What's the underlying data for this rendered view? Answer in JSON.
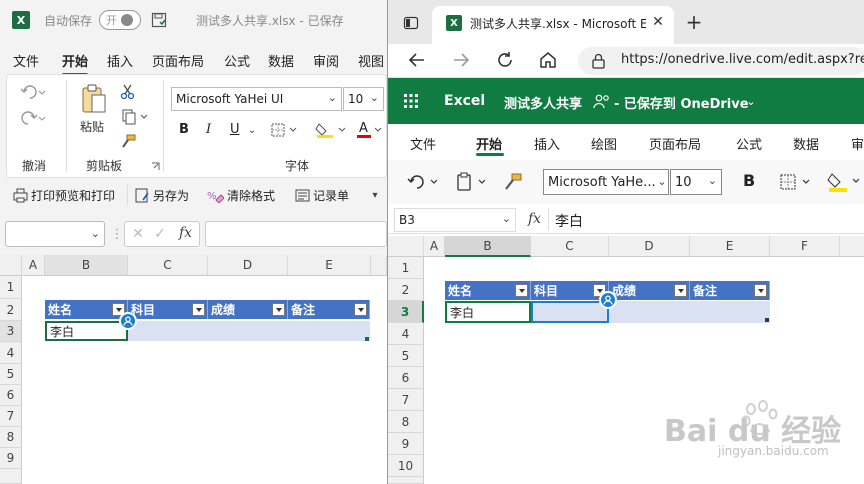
{
  "left_window": {
    "autosave_label": "自动保存",
    "autosave_toggle": "开",
    "title": "测试多人共享.xlsx - 已保存",
    "menu": [
      "文件",
      "开始",
      "插入",
      "页面布局",
      "公式",
      "数据",
      "审阅",
      "视图"
    ],
    "active_menu": "开始",
    "ribbon": {
      "undo_group": "撤消",
      "paste_label": "粘贴",
      "clipboard_group": "剪贴板",
      "font_name": "Microsoft YaHei UI",
      "font_size": "10",
      "font_group": "字体",
      "bold": "B",
      "italic": "I",
      "underline": "U",
      "font_color_letter": "A"
    },
    "quick_access": [
      "打印预览和打印",
      "另存为",
      "清除格式",
      "记录单"
    ],
    "formula_fx": "fx",
    "columns": [
      "A",
      "B",
      "C",
      "D",
      "E"
    ],
    "rows": [
      "1",
      "2",
      "3",
      "4",
      "5",
      "6",
      "7",
      "8",
      "9"
    ],
    "table_headers": [
      "姓名",
      "科目",
      "成绩",
      "备注"
    ],
    "table_data": [
      [
        "李白",
        "",
        "",
        ""
      ]
    ]
  },
  "right_window": {
    "tab_title": "测试多人共享.xlsx - Microsoft Ex",
    "url": "https://onedrive.live.com/edit.aspx?resi",
    "app_name": "Excel",
    "doc_title": "测试多人共享",
    "save_status": "- 已保存到 OneDrive",
    "menu": [
      "文件",
      "开始",
      "插入",
      "绘图",
      "页面布局",
      "公式",
      "数据",
      "审"
    ],
    "active_menu": "开始",
    "font_name": "Microsoft YaHe...",
    "font_size": "10",
    "bold": "B",
    "name_box": "B3",
    "formula_fx": "fx",
    "formula_value": "李白",
    "columns": [
      "A",
      "B",
      "C",
      "D",
      "E",
      "F"
    ],
    "rows": [
      "1",
      "2",
      "3",
      "4",
      "5",
      "6",
      "7",
      "8",
      "9",
      "10"
    ],
    "table_headers": [
      "姓名",
      "科目",
      "成绩",
      "备注"
    ],
    "table_data": [
      [
        "李白",
        "",
        "",
        ""
      ]
    ]
  },
  "watermark": {
    "brand": "Bai du 经验",
    "domain": "jingyan.baidu.com"
  },
  "colors": {
    "excel_green": "#107c41",
    "table_header": "#4472c4",
    "table_row": "#d9e1f2",
    "coauthor_blue": "#1b7fd1"
  }
}
